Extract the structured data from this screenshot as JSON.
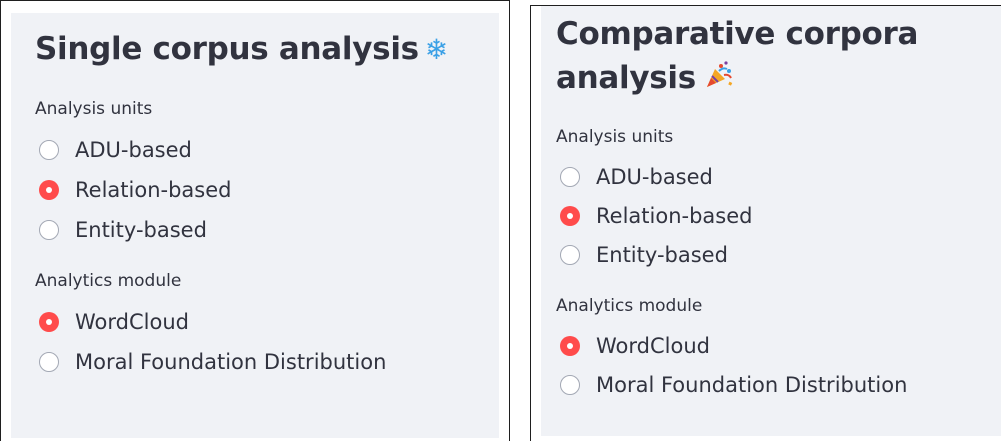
{
  "single": {
    "title": "Single corpus analysis",
    "title_icon": "snowflake-emoji",
    "units": {
      "label": "Analysis units",
      "options": [
        "ADU-based",
        "Relation-based",
        "Entity-based"
      ],
      "selected": "Relation-based"
    },
    "module": {
      "label": "Analytics module",
      "options": [
        "WordCloud",
        "Moral Foundation Distribution"
      ],
      "selected": "WordCloud"
    }
  },
  "comparative": {
    "title_line1": "Comparative corpora",
    "title_line2": "analysis",
    "title_icon": "party-popper-emoji",
    "units": {
      "label": "Analysis units",
      "options": [
        "ADU-based",
        "Relation-based",
        "Entity-based"
      ],
      "selected": "Relation-based"
    },
    "module": {
      "label": "Analytics module",
      "options": [
        "WordCloud",
        "Moral Foundation Distribution"
      ],
      "selected": "WordCloud"
    }
  },
  "colors": {
    "sidebar_bg": "#f0f2f6",
    "accent": "#ff4b4b",
    "text": "#31333f"
  }
}
